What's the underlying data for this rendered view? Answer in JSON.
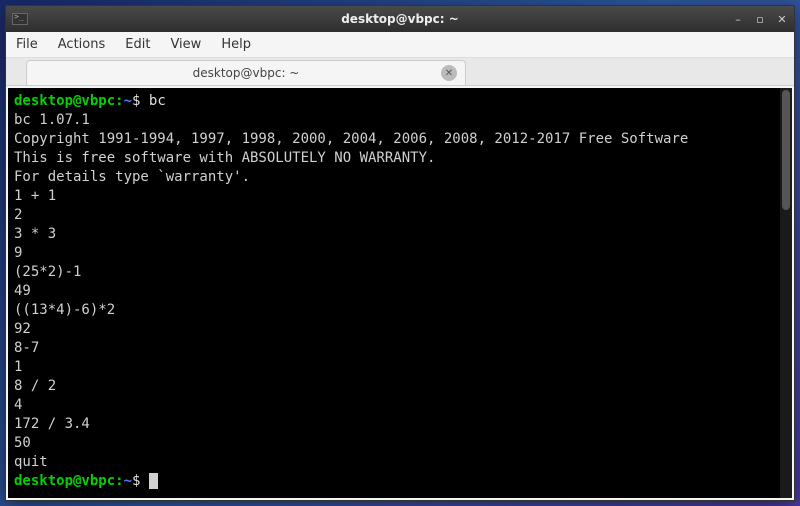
{
  "window": {
    "title": "desktop@vbpc: ~"
  },
  "menubar": {
    "file": "File",
    "actions": "Actions",
    "edit": "Edit",
    "view": "View",
    "help": "Help"
  },
  "tab": {
    "title": "desktop@vbpc: ~"
  },
  "prompt": {
    "user_host": "desktop@vbpc",
    "colon": ":",
    "path": "~",
    "dollar": "$ "
  },
  "session": {
    "cmd1": "bc",
    "out_version": "bc 1.07.1",
    "out_copy1": "Copyright 1991-1994, 1997, 1998, 2000, 2004, 2006, 2008, 2012-2017 Free Software",
    "out_copy2": "This is free software with ABSOLUTELY NO WARRANTY.",
    "out_copy3": "For details type `warranty'.",
    "in1": "1 + 1",
    "out1": "2",
    "in2": "3 * 3",
    "out2": "9",
    "in3": "(25*2)-1",
    "out3": "49",
    "in4": "((13*4)-6)*2",
    "out4": "92",
    "in5": "8-7",
    "out5": "1",
    "in6": "8 / 2",
    "out6": "4",
    "in7": "172 / 3.4",
    "out7": "50",
    "in8": "quit"
  }
}
